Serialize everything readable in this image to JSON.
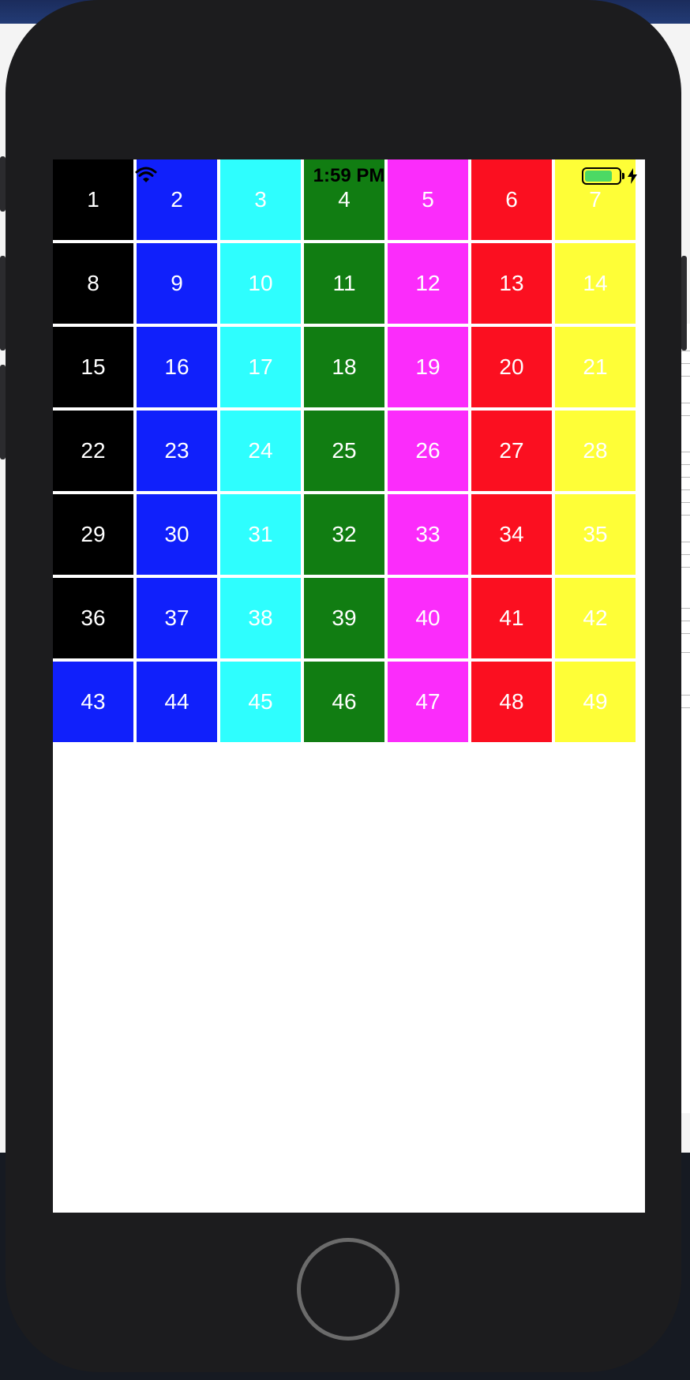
{
  "status_bar": {
    "time": "1:59 PM",
    "icons": [
      "wifi-icon",
      "battery-icon",
      "charging-bolt-icon"
    ],
    "battery_color": "#4cd964",
    "battery_level": 0.8
  },
  "grid": {
    "rows": 7,
    "columns": 7,
    "text_color": "#ffffff",
    "cells": [
      {
        "label": "1",
        "color": "#000000"
      },
      {
        "label": "2",
        "color": "#1020fb"
      },
      {
        "label": "3",
        "color": "#2efefe"
      },
      {
        "label": "4",
        "color": "#117d12"
      },
      {
        "label": "5",
        "color": "#fb2cfb"
      },
      {
        "label": "6",
        "color": "#fb0f20"
      },
      {
        "label": "7",
        "color": "#fefe37"
      },
      {
        "label": "8",
        "color": "#000000"
      },
      {
        "label": "9",
        "color": "#1020fb"
      },
      {
        "label": "10",
        "color": "#2efefe"
      },
      {
        "label": "11",
        "color": "#117d12"
      },
      {
        "label": "12",
        "color": "#fb2cfb"
      },
      {
        "label": "13",
        "color": "#fb0f20"
      },
      {
        "label": "14",
        "color": "#fefe37"
      },
      {
        "label": "15",
        "color": "#000000"
      },
      {
        "label": "16",
        "color": "#1020fb"
      },
      {
        "label": "17",
        "color": "#2efefe"
      },
      {
        "label": "18",
        "color": "#117d12"
      },
      {
        "label": "19",
        "color": "#fb2cfb"
      },
      {
        "label": "20",
        "color": "#fb0f20"
      },
      {
        "label": "21",
        "color": "#fefe37"
      },
      {
        "label": "22",
        "color": "#000000"
      },
      {
        "label": "23",
        "color": "#1020fb"
      },
      {
        "label": "24",
        "color": "#2efefe"
      },
      {
        "label": "25",
        "color": "#117d12"
      },
      {
        "label": "26",
        "color": "#fb2cfb"
      },
      {
        "label": "27",
        "color": "#fb0f20"
      },
      {
        "label": "28",
        "color": "#fefe37"
      },
      {
        "label": "29",
        "color": "#000000"
      },
      {
        "label": "30",
        "color": "#1020fb"
      },
      {
        "label": "31",
        "color": "#2efefe"
      },
      {
        "label": "32",
        "color": "#117d12"
      },
      {
        "label": "33",
        "color": "#fb2cfb"
      },
      {
        "label": "34",
        "color": "#fb0f20"
      },
      {
        "label": "35",
        "color": "#fefe37"
      },
      {
        "label": "36",
        "color": "#000000"
      },
      {
        "label": "37",
        "color": "#1020fb"
      },
      {
        "label": "38",
        "color": "#2efefe"
      },
      {
        "label": "39",
        "color": "#117d12"
      },
      {
        "label": "40",
        "color": "#fb2cfb"
      },
      {
        "label": "41",
        "color": "#fb0f20"
      },
      {
        "label": "42",
        "color": "#fefe37"
      },
      {
        "label": "43",
        "color": "#1020fb"
      },
      {
        "label": "44",
        "color": "#1020fb"
      },
      {
        "label": "45",
        "color": "#2efefe"
      },
      {
        "label": "46",
        "color": "#117d12"
      },
      {
        "label": "47",
        "color": "#fb2cfb"
      },
      {
        "label": "48",
        "color": "#fb0f20"
      },
      {
        "label": "49",
        "color": "#fefe37"
      }
    ]
  },
  "device": {
    "icons": [
      "home-button"
    ]
  }
}
